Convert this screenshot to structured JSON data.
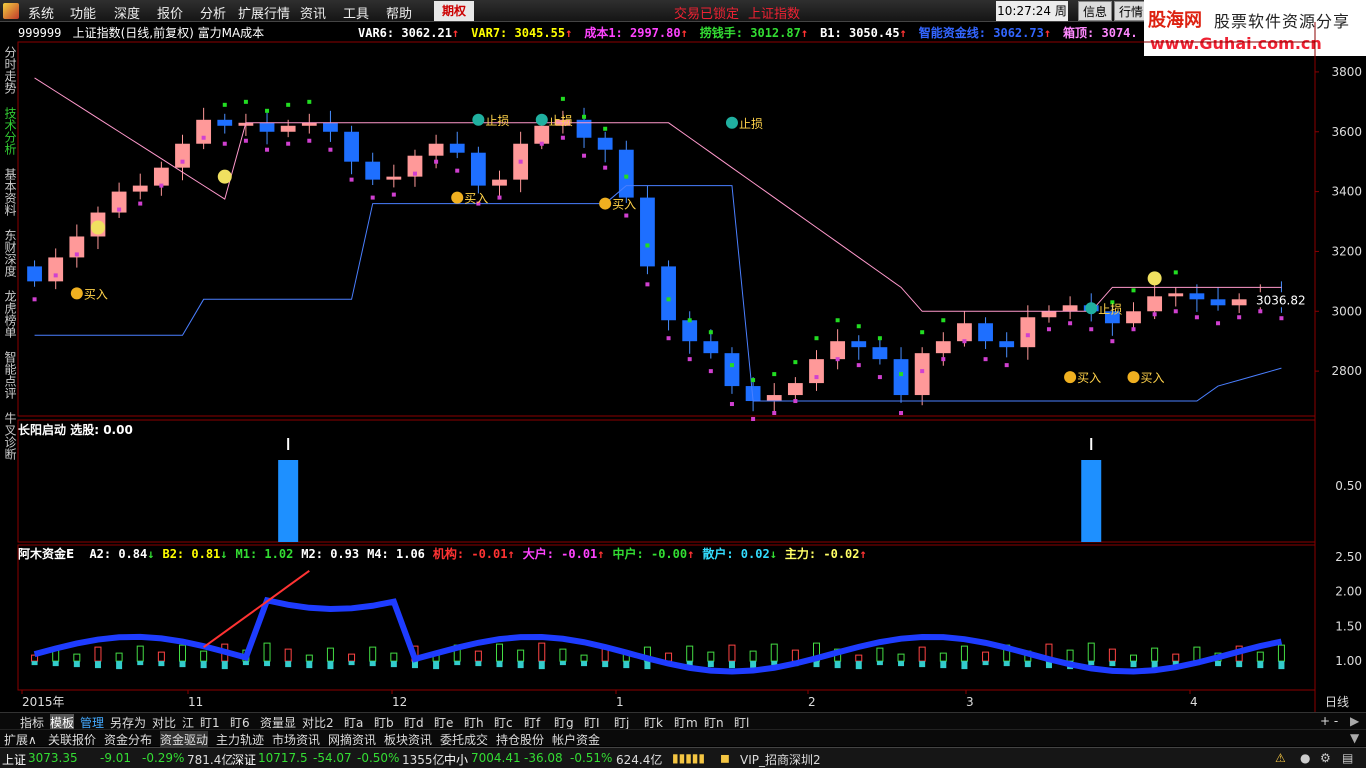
{
  "menu": {
    "items": [
      "系统",
      "功能",
      "深度",
      "报价",
      "分析",
      "扩展行情",
      "资讯",
      "工具",
      "帮助"
    ],
    "highlight": "期权",
    "notice1": "交易已锁定",
    "notice2": "上证指数",
    "time": "10:27:24",
    "weekday": "周五",
    "info_btn": "信息",
    "quote_btn": "行情"
  },
  "banner": {
    "brand": "股海网",
    "slogan": "股票软件资源分享",
    "url": "www.Guhai.com.cn"
  },
  "leftnav": [
    "分时走势",
    "技术分析",
    "基本资料",
    "东财深度",
    "龙虎榜单",
    "智能点评",
    "牛叉诊断"
  ],
  "main": {
    "code": "999999",
    "title": "上证指数(日线,前复权) 富力MA成本",
    "indicators": [
      {
        "label": "VAR6:",
        "value": "3062.21",
        "arrow": "↑",
        "color": "#ffffff"
      },
      {
        "label": "VAR7:",
        "value": "3045.55",
        "arrow": "↑",
        "color": "#ffff00"
      },
      {
        "label": "成本1:",
        "value": "2997.80",
        "arrow": "↑",
        "color": "#ff44ff"
      },
      {
        "label": "捞钱手:",
        "value": "3012.87",
        "arrow": "↑",
        "color": "#33dd33"
      },
      {
        "label": "B1:",
        "value": "3050.45",
        "arrow": "↑",
        "color": "#ffffff"
      },
      {
        "label": "智能资金线:",
        "value": "3062.73",
        "arrow": "↑",
        "color": "#3366ff"
      },
      {
        "label": "箱顶:",
        "value": "3074.",
        "arrow": "",
        "color": "#ff88ff"
      }
    ],
    "price_axis": [
      "3800",
      "3600",
      "3400",
      "3200",
      "3000",
      "2800"
    ],
    "last_price": "3036.82",
    "signals": {
      "buy": "买入",
      "stop": "止损"
    }
  },
  "panel2": {
    "name": "长阳启动",
    "label": "选股:",
    "value": "0.00",
    "axis": [
      "0.50"
    ]
  },
  "panel3": {
    "name": "阿木资金E",
    "items": [
      {
        "label": "A2:",
        "value": "0.84",
        "arrow": "↓",
        "color": "#ffffff"
      },
      {
        "label": "B2:",
        "value": "0.81",
        "arrow": "↓",
        "color": "#ffff00"
      },
      {
        "label": "M1:",
        "value": "1.02",
        "arrow": "",
        "color": "#33dd33"
      },
      {
        "label": "M2:",
        "value": "0.93",
        "arrow": "",
        "color": "#ffffff"
      },
      {
        "label": "M4:",
        "value": "1.06",
        "arrow": "",
        "color": "#ffffff"
      },
      {
        "label": "机构:",
        "value": "-0.01",
        "arrow": "↑",
        "color": "#ff3333"
      },
      {
        "label": "大户:",
        "value": "-0.01",
        "arrow": "↑",
        "color": "#ff44ff"
      },
      {
        "label": "中户:",
        "value": "-0.00",
        "arrow": "↑",
        "color": "#33dd33"
      },
      {
        "label": "散户:",
        "value": "0.02",
        "arrow": "↓",
        "color": "#33ddff"
      },
      {
        "label": "主力:",
        "value": "-0.02",
        "arrow": "↑",
        "color": "#ffff66"
      }
    ],
    "axis": [
      "2.50",
      "2.00",
      "1.50",
      "1.00"
    ]
  },
  "date_axis": {
    "labels": [
      "2015年",
      "11",
      "12",
      "1",
      "2",
      "3",
      "4"
    ],
    "period": "日线"
  },
  "tabs": [
    "指标",
    "模板",
    "管理",
    "另存为",
    "对比",
    "江",
    "盯1",
    "盯6",
    "资量显",
    "对比2",
    "盯a",
    "盯b",
    "盯d",
    "盯e",
    "盯h",
    "盯c",
    "盯f",
    "盯g",
    "盯I",
    "盯j",
    "盯k",
    "盯m",
    "盯n",
    "盯l"
  ],
  "functions": [
    "扩展∧",
    "关联报价",
    "资金分布",
    "资金驱动",
    "主力轨迹",
    "市场资讯",
    "网摘资讯",
    "板块资讯",
    "委托成交",
    "持仓股份",
    "帐户资金"
  ],
  "status": {
    "sh_name": "上证",
    "sh_price": "3073.35",
    "sh_chg": "-9.01",
    "sh_pct": "-0.29%",
    "sh_amt": "781.4亿",
    "sz_name": "深证",
    "sz_price": "10717.5",
    "sz_chg": "-54.07",
    "sz_pct": "-0.50%",
    "sz_amt": "1355亿",
    "zx_name": "中小",
    "zx_price": "7004.41",
    "zx_chg": "-36.08",
    "zx_pct": "-0.51%",
    "zx_amt": "624.4亿",
    "vip": "VIP_招商深圳2"
  },
  "chart_data": {
    "type": "candlestick",
    "x_labels": [
      "2015年",
      "11",
      "12",
      "1",
      "2",
      "3",
      "4"
    ],
    "ylim": [
      2650,
      3900
    ],
    "yticks": [
      2800,
      3000,
      3200,
      3400,
      3600,
      3800
    ],
    "close_approx": [
      3100,
      3180,
      3250,
      3330,
      3400,
      3420,
      3480,
      3560,
      3640,
      3620,
      3630,
      3600,
      3620,
      3630,
      3600,
      3500,
      3440,
      3450,
      3520,
      3560,
      3530,
      3420,
      3440,
      3560,
      3620,
      3640,
      3580,
      3540,
      3380,
      3150,
      2970,
      2900,
      2860,
      2750,
      2700,
      2720,
      2760,
      2840,
      2900,
      2880,
      2840,
      2720,
      2860,
      2900,
      2960,
      2900,
      2880,
      2980,
      3000,
      3020,
      3000,
      2960,
      3000,
      3050,
      3060,
      3040,
      3020,
      3040,
      3060,
      3036.82
    ]
  }
}
